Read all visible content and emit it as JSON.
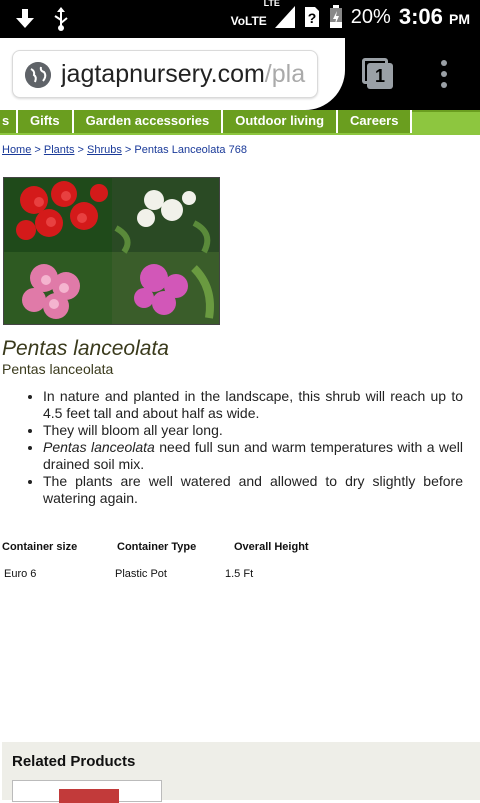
{
  "status_bar": {
    "volte": "VoLTE",
    "lte": "LTE",
    "battery_percent": "20%",
    "time": "3:06",
    "ampm": "PM"
  },
  "browser": {
    "url_main": "jagtapnursery.com",
    "url_faded": "/pla",
    "tab_count": "1"
  },
  "nav": {
    "items": [
      {
        "label": "s"
      },
      {
        "label": "Gifts"
      },
      {
        "label": "Garden accessories"
      },
      {
        "label": "Outdoor living"
      },
      {
        "label": "Careers"
      }
    ]
  },
  "breadcrumb": {
    "home": "Home",
    "sep1": " > ",
    "plants": "Plants",
    "sep2": " > ",
    "shrubs": "Shrubs",
    "current": " > Pentas Lanceolata 768"
  },
  "product": {
    "title": "Pentas lanceolata",
    "subtitle": "Pentas lanceolata",
    "description": [
      "In nature and planted in the landscape, this shrub will reach up to 4.5 feet tall and about half as wide.",
      "They will bloom all year long.",
      "need full sun and warm temperatures with a well drained soil mix.",
      "The plants are well watered and allowed to dry slightly before watering again."
    ],
    "description_italic": "Pentas lanceolata"
  },
  "specs": {
    "headers": [
      "Container size",
      "Container Type",
      "Overall Height"
    ],
    "values": [
      "Euro 6",
      "Plastic Pot",
      "1.5 Ft"
    ]
  },
  "related": {
    "title": "Related Products"
  },
  "colors": {
    "nav_green": "#6a9e1f",
    "nav_light": "#8dc63f",
    "link_blue": "#1a3a99"
  }
}
